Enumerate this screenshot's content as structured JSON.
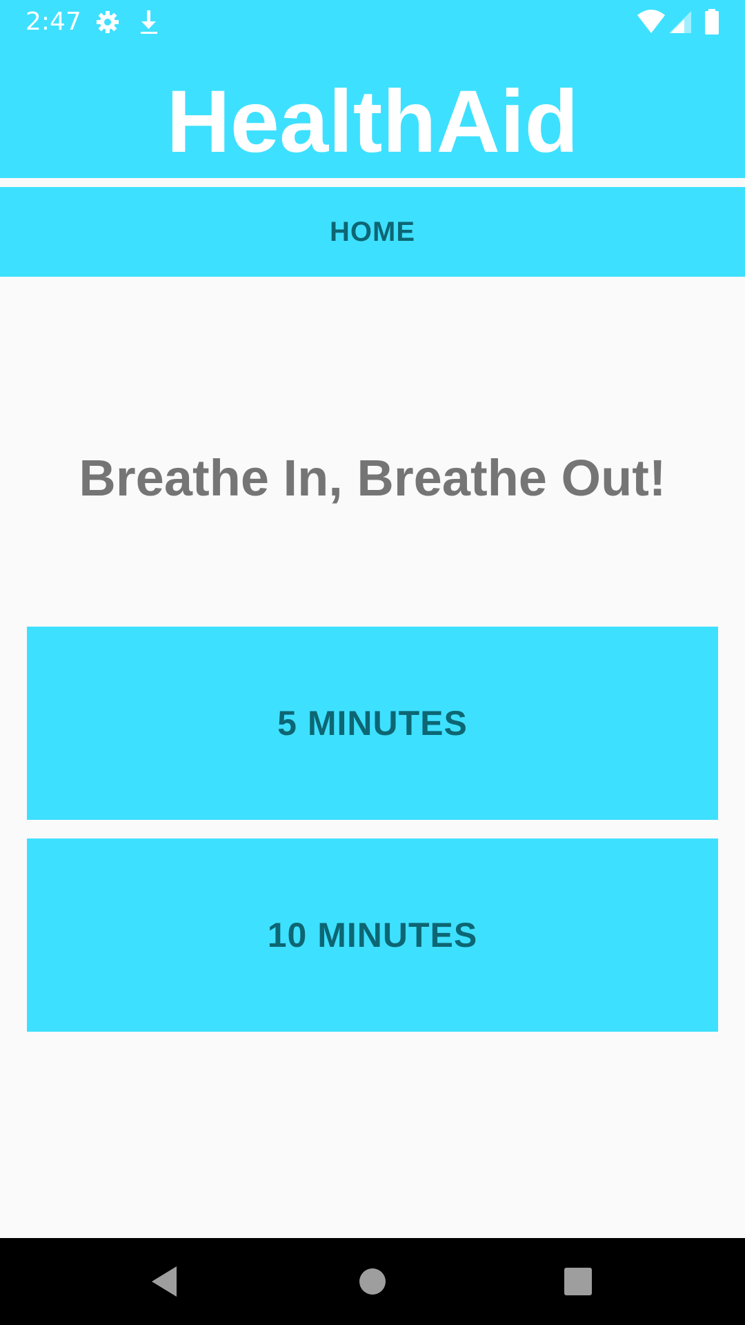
{
  "status_bar": {
    "time": "2:47",
    "icons": [
      "gear-icon",
      "download-icon",
      "wifi-icon",
      "cell-signal-icon",
      "battery-icon"
    ]
  },
  "header": {
    "title": "HealthAid"
  },
  "tabs": [
    {
      "label": "HOME"
    }
  ],
  "main": {
    "heading": "Breathe In, Breathe Out!",
    "buttons": [
      {
        "label": "5 MINUTES"
      },
      {
        "label": "10 MINUTES"
      }
    ]
  },
  "nav_bar": {
    "icons": [
      "back-icon",
      "home-icon",
      "recents-icon"
    ]
  },
  "colors": {
    "accent": "#3ee0ff",
    "accent_text": "#0d6673",
    "heading_text": "#757575",
    "background": "#fafafa"
  }
}
